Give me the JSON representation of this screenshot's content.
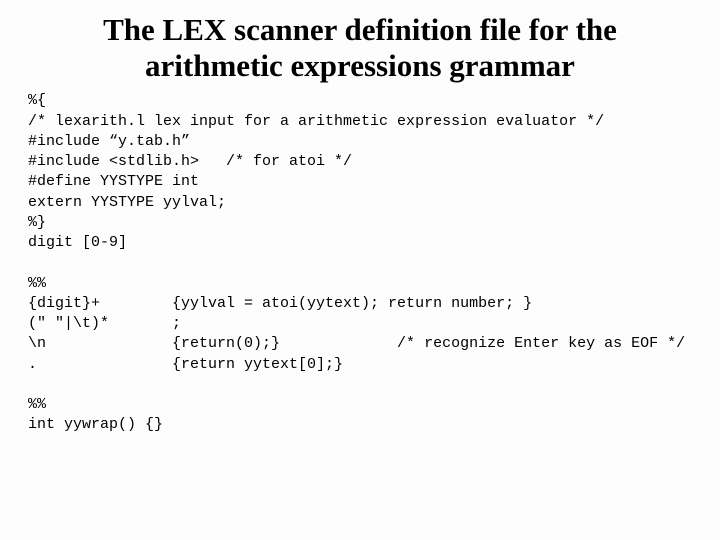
{
  "title": "The LEX scanner definition file for the arithmetic expressions grammar",
  "code": "%{\n/* lexarith.l lex input for a arithmetic expression evaluator */\n#include “y.tab.h”\n#include <stdlib.h>   /* for atoi */\n#define YYSTYPE int\nextern YYSTYPE yylval;\n%}\ndigit [0-9]\n\n%%\n{digit}+        {yylval = atoi(yytext); return number; }\n(\" \"|\\t)*       ;\n\\n              {return(0);}             /* recognize Enter key as EOF */\n.               {return yytext[0];}\n\n%%\nint yywrap() {}"
}
